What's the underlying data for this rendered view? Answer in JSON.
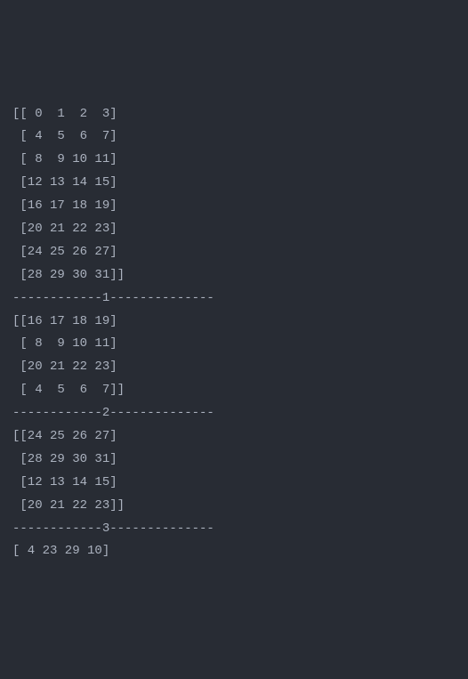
{
  "output": {
    "lines": [
      "[[ 0  1  2  3]",
      " [ 4  5  6  7]",
      " [ 8  9 10 11]",
      " [12 13 14 15]",
      " [16 17 18 19]",
      " [20 21 22 23]",
      " [24 25 26 27]",
      " [28 29 30 31]]",
      "------------1--------------",
      "[[16 17 18 19]",
      " [ 8  9 10 11]",
      " [20 21 22 23]",
      " [ 4  5  6  7]]",
      "------------2--------------",
      "[[24 25 26 27]",
      " [28 29 30 31]",
      " [12 13 14 15]",
      " [20 21 22 23]]",
      "------------3--------------",
      "[ 4 23 29 10]"
    ]
  }
}
